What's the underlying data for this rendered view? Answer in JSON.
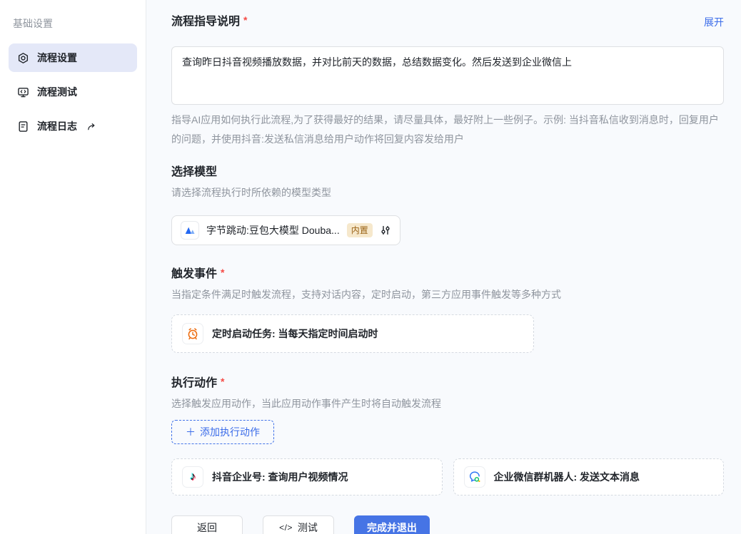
{
  "sidebar": {
    "section_label": "基础设置",
    "items": [
      {
        "label": "流程设置",
        "active": true
      },
      {
        "label": "流程测试",
        "active": false
      },
      {
        "label": "流程日志",
        "active": false
      }
    ]
  },
  "guidance": {
    "title": "流程指导说明",
    "required_mark": "*",
    "expand_label": "展开",
    "value": "查询昨日抖音视频播放数据，并对比前天的数据，总结数据变化。然后发送到企业微信上",
    "help_text": "指导AI应用如何执行此流程,为了获得最好的结果，请尽量具体，最好附上一些例子。示例: 当抖音私信收到消息时，回复用户的问题，并使用抖音:发送私信消息给用户动作将回复内容发给用户"
  },
  "model": {
    "title": "选择模型",
    "subtitle": "请选择流程执行时所依赖的模型类型",
    "selected_name": "字节跳动:豆包大模型 Douba...",
    "badge": "内置"
  },
  "trigger": {
    "title": "触发事件",
    "required_mark": "*",
    "subtitle": "当指定条件满足时触发流程，支持对话内容，定时启动，第三方应用事件触发等多种方式",
    "event_label": "定时启动任务: 当每天指定时间启动时"
  },
  "actions": {
    "title": "执行动作",
    "required_mark": "*",
    "subtitle": "选择触发应用动作，当此应用动作事件产生时将自动触发流程",
    "add_button_label": "添加执行动作",
    "cards": [
      {
        "label": "抖音企业号: 查询用户视频情况",
        "app": "douyin"
      },
      {
        "label": "企业微信群机器人: 发送文本消息",
        "app": "wecom"
      }
    ]
  },
  "footer": {
    "back_label": "返回",
    "test_label": "测试",
    "done_label": "完成并退出"
  },
  "icons": {
    "plus": "＋",
    "code": "</>",
    "note": "♪"
  },
  "colors": {
    "accent_blue": "#3b6ce9",
    "primary_button": "#4674e5",
    "active_item_bg": "#e4e8f8",
    "badge_bg": "#f6e8cc",
    "badge_text": "#9a6214",
    "alarm_orange": "#ed6a0c",
    "required_red": "#f54a45"
  }
}
